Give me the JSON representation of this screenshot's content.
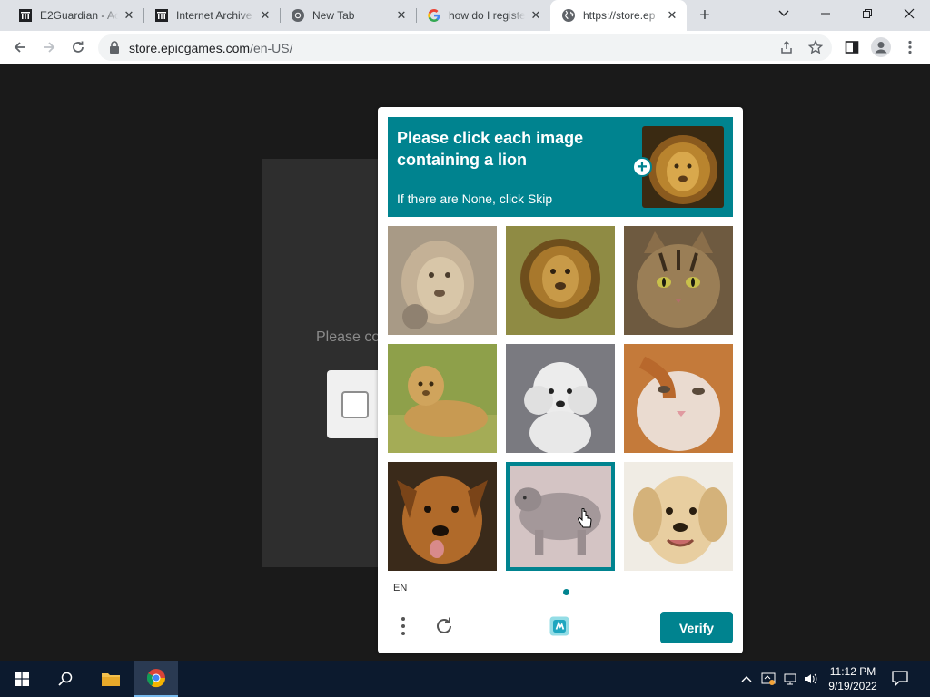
{
  "browser": {
    "tabs": [
      {
        "title": "E2Guardian - Ac",
        "icon": "archive-icon",
        "active": false
      },
      {
        "title": "Internet Archive",
        "icon": "archive-icon",
        "active": false
      },
      {
        "title": "New Tab",
        "icon": "chrome-icon",
        "active": false
      },
      {
        "title": "how do I registe",
        "icon": "google-icon",
        "active": false
      },
      {
        "title": "https://store.ep",
        "icon": "globe-icon",
        "active": true
      }
    ],
    "address": {
      "host": "store.epicgames.com",
      "path": "/en-US/"
    }
  },
  "page": {
    "prompt_text": "Please co"
  },
  "captcha": {
    "title": "Please click each image containing a lion",
    "subtitle": "If there are None, click Skip",
    "tiles": [
      {
        "label": "lioness-closeup",
        "selected": false
      },
      {
        "label": "lion-male",
        "selected": false
      },
      {
        "label": "tabby-cat",
        "selected": false
      },
      {
        "label": "lion-cub-grass",
        "selected": false
      },
      {
        "label": "white-poodle",
        "selected": false
      },
      {
        "label": "orange-white-cat",
        "selected": false
      },
      {
        "label": "brown-dog",
        "selected": false
      },
      {
        "label": "grey-animal",
        "selected": true
      },
      {
        "label": "golden-puppy",
        "selected": false
      }
    ],
    "language": "EN",
    "verify_label": "Verify",
    "accent": "#00838f"
  },
  "taskbar": {
    "time": "11:12 PM",
    "date": "9/19/2022"
  }
}
